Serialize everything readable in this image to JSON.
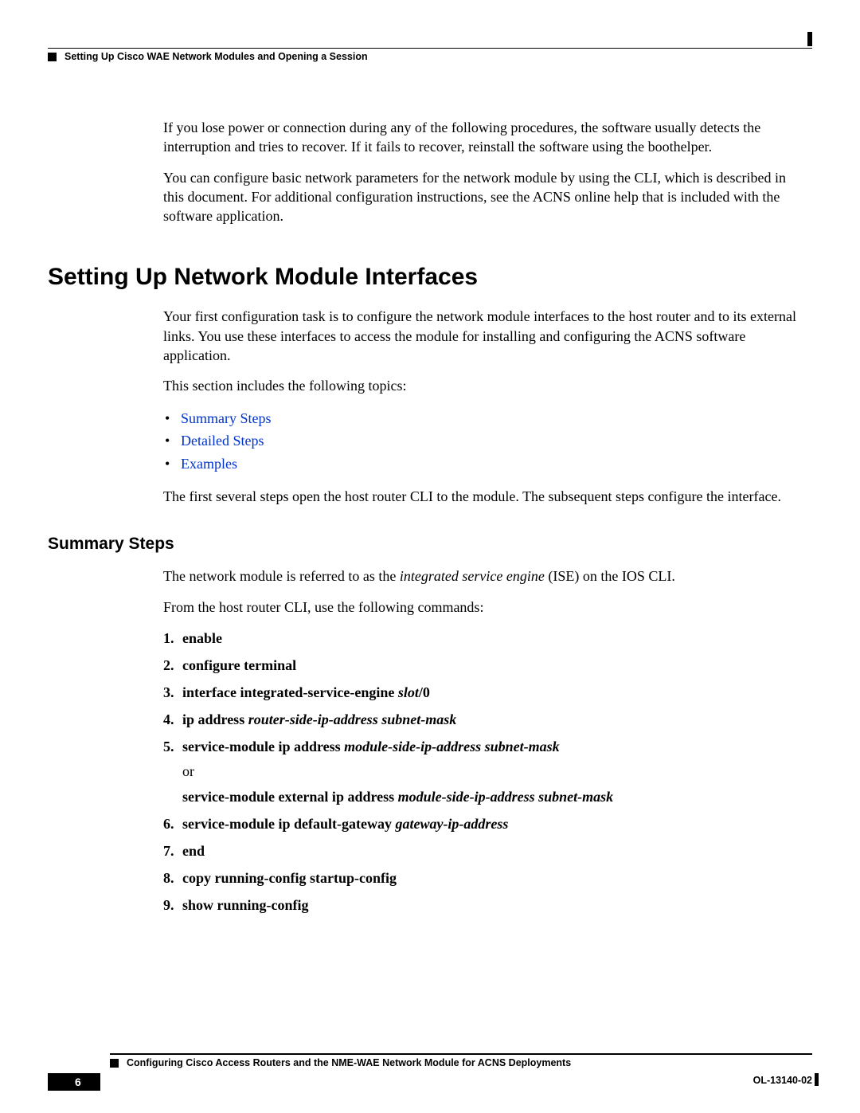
{
  "header": {
    "breadcrumb": "Setting Up Cisco WAE Network Modules and Opening a Session"
  },
  "intro": {
    "p1": "If you lose power or connection during any of the following procedures, the software usually detects the interruption and tries to recover. If it fails to recover, reinstall the software using the boothelper.",
    "p2": "You can configure basic network parameters for the network module by using the CLI, which is described in this document. For additional configuration instructions, see the ACNS online help that is included with the software application."
  },
  "section": {
    "title": "Setting Up Network Module Interfaces",
    "p1": "Your first configuration task is to configure the network module interfaces to the host router and to its external links. You use these interfaces to access the module for installing and configuring the ACNS software application.",
    "p2": "This section includes the following topics:",
    "links": {
      "l1": "Summary Steps",
      "l2": "Detailed Steps",
      "l3": "Examples"
    },
    "p3": "The first several steps open the host router CLI to the module. The subsequent steps configure the interface."
  },
  "summary": {
    "title": "Summary Steps",
    "p1a": "The network module is referred to as the ",
    "p1b": "integrated service engine",
    "p1c": " (ISE) on the IOS CLI.",
    "p2": "From the host router CLI, use the following commands:",
    "steps": {
      "s1": "enable",
      "s2": "configure terminal",
      "s3a": "interface integrated-service-engine ",
      "s3b": "slot",
      "s3c": "/0",
      "s4a": "ip address ",
      "s4b": "router-side-ip-address subnet-mask",
      "s5a": "service-module ip address ",
      "s5b": "module-side-ip-address subnet-mask",
      "s5or": "or",
      "s5c": "service-module external ip address ",
      "s5d": "module-side-ip-address subnet-mask",
      "s6a": "service-module ip default-gateway ",
      "s6b": "gateway-ip-address",
      "s7": "end",
      "s8": "copy running-config startup-config",
      "s9": "show running-config"
    }
  },
  "footer": {
    "title": "Configuring Cisco Access Routers and the NME-WAE Network Module for ACNS Deployments",
    "page": "6",
    "docid": "OL-13140-02"
  }
}
